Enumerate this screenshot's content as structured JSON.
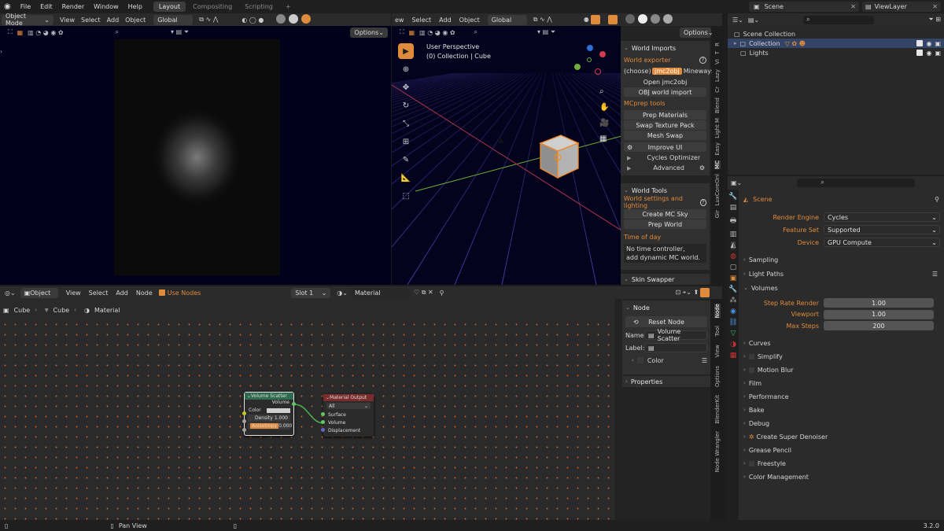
{
  "topbar": {
    "menus": [
      "File",
      "Edit",
      "Render",
      "Window",
      "Help"
    ],
    "workspaces": [
      "Layout",
      "Compositing",
      "Scripting"
    ],
    "add_tab": "+",
    "scene_label": "Scene",
    "viewlayer_label": "ViewLayer"
  },
  "left_view": {
    "mode": "Object Mode",
    "menus": [
      "View",
      "Select",
      "Add",
      "Object"
    ],
    "orientation": "Global",
    "options": "Options"
  },
  "view3d": {
    "menus": [
      "ew",
      "Select",
      "Add",
      "Object"
    ],
    "orientation": "Global",
    "options": "Options",
    "title": "User Perspective",
    "subtitle": "(0) Collection | Cube"
  },
  "mcprep": {
    "world_imports": "World Imports",
    "world_exporter": "World exporter",
    "choose": "(choose)",
    "jmc2obj": "jmc2obj",
    "mineways": "Mineways",
    "open_jmc2obj": "Open jmc2obj",
    "obj_import": "OBJ world import",
    "mcprep_tools": "MCprep tools",
    "prep_materials": "Prep Materials",
    "swap_texture": "Swap Texture Pack",
    "mesh_swap": "Mesh Swap",
    "improve_ui": "Improve UI",
    "cycles_optimizer": "Cycles Optimizer",
    "advanced": "Advanced",
    "world_tools": "World Tools",
    "world_settings": "World settings and lighting",
    "create_sky": "Create MC Sky",
    "prep_world": "Prep World",
    "time_of_day": "Time of day",
    "no_time": "No time controller,",
    "add_dynamic": "add dynamic MC world.",
    "skin_swapper": "Skin Swapper"
  },
  "side_tabs_3d": [
    "R",
    "T",
    "VI",
    "Lazy",
    "Cr",
    "Blend",
    "Light M",
    "Easy",
    "MC",
    "LuxCoreOnl",
    "Gir"
  ],
  "node_editor": {
    "editor": "Object",
    "menus": [
      "View",
      "Select",
      "Add",
      "Node"
    ],
    "use_nodes": "Use Nodes",
    "slot": "Slot 1",
    "material": "Material",
    "breadcrumb": [
      "Cube",
      "Cube",
      "Material"
    ],
    "status_left": "Pan View"
  },
  "node_panel": {
    "title": "Node",
    "reset": "Reset Node",
    "name_label": "Name:",
    "name_value": "Volume Scatter",
    "label_label": "Label:",
    "color": "Color",
    "properties": "Properties"
  },
  "node_side_tabs": [
    "Node",
    "Tool",
    "View",
    "Options",
    "BlenderKit",
    "Node Wrangler"
  ],
  "nodes": {
    "scatter_title": "Volume Scatter",
    "scatter_out": "Volume",
    "scatter_color": "Color",
    "scatter_density": "Density",
    "scatter_density_val": "1.000",
    "scatter_aniso": "Anisotropy",
    "scatter_aniso_val": "0.000",
    "output_title": "Material Output",
    "output_target": "All",
    "output_surface": "Surface",
    "output_volume": "Volume",
    "output_disp": "Displacement"
  },
  "outliner": {
    "scene_collection": "Scene Collection",
    "collection": "Collection",
    "lights": "Lights"
  },
  "properties": {
    "scene": "Scene",
    "render_engine_label": "Render Engine",
    "render_engine": "Cycles",
    "feature_set_label": "Feature Set",
    "feature_set": "Supported",
    "device_label": "Device",
    "device": "GPU Compute",
    "sampling": "Sampling",
    "light_paths": "Light Paths",
    "volumes": "Volumes",
    "step_rate_label": "Step Rate Render",
    "step_rate": "1.00",
    "viewport_label": "Viewport",
    "viewport": "1.00",
    "max_steps_label": "Max Steps",
    "max_steps": "200",
    "curves": "Curves",
    "simplify": "Simplify",
    "motion_blur": "Motion Blur",
    "film": "Film",
    "performance": "Performance",
    "bake": "Bake",
    "debug": "Debug",
    "denoiser": "Create Super Denoiser",
    "grease_pencil": "Grease Pencil",
    "freestyle": "Freestyle",
    "color_mgmt": "Color Management"
  },
  "status": {
    "version": "3.2.0"
  },
  "colors": {
    "accent": "#e08a3c",
    "selected_blue": "#4772b3",
    "node_green": "#2f6b50",
    "node_red": "#7a2b2b"
  }
}
